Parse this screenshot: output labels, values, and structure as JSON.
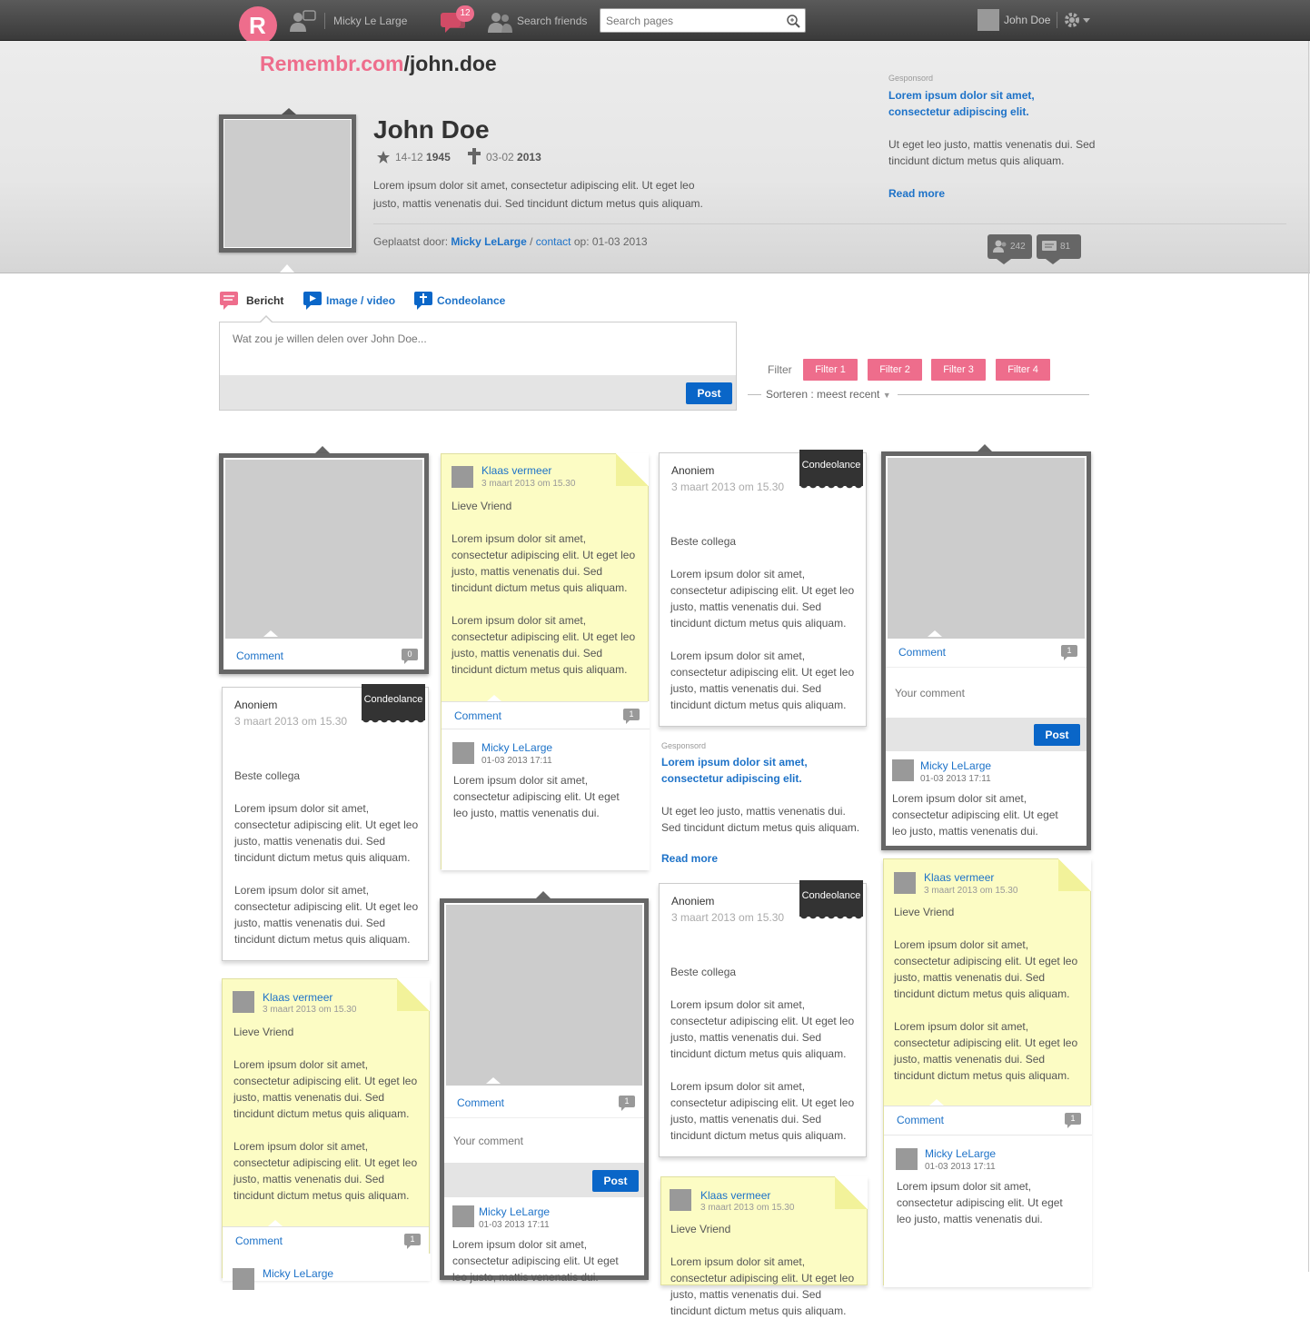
{
  "topbar": {
    "user_name": "Micky Le Large",
    "notification_count": "12",
    "search_friends": "Search friends",
    "search_placeholder": "Search pages",
    "account_name": "John Doe"
  },
  "logo": {
    "brand": "Remembr.com",
    "slug": "/john.doe"
  },
  "profile": {
    "name": "John Doe",
    "birth_day": "14-12",
    "birth_year": "1945",
    "death_day": "03-02",
    "death_year": "2013",
    "bio": "Lorem ipsum dolor sit amet, consectetur adipiscing elit. Ut eget leo justo, mattis venenatis dui. Sed tincidunt dictum metus quis aliquam.",
    "posted_by_label": "Geplaatst door:",
    "posted_by_name": "Micky LeLarge",
    "contact_label": "contact",
    "posted_on": "op: 01-03 2013",
    "followers_count": "242",
    "messages_count": "81"
  },
  "sponsored_header": {
    "label": "Gesponsord",
    "title": "Lorem ipsum dolor sit amet, consectetur adipiscing elit.",
    "body": "Ut eget leo justo, mattis venenatis dui. Sed tincidunt dictum metus quis aliquam.",
    "read_more": "Read more"
  },
  "compose": {
    "tabs": [
      "Bericht",
      "Image / video",
      "Condeolance"
    ],
    "placeholder": "Wat zou je willen delen over John Doe...",
    "post_label": "Post"
  },
  "filters": {
    "label": "Filter",
    "buttons": [
      "Filter 1",
      "Filter 2",
      "Filter 3",
      "Filter 4"
    ],
    "sort": "Sorteren : meest recent"
  },
  "common": {
    "comment": "Comment",
    "your_comment": "Your comment",
    "post": "Post",
    "condolence_badge": "Condeolance",
    "anon": "Anoniem",
    "date": "3 maart 2013 om 15.30",
    "greeting_colleague": "Beste collega",
    "greeting_friend": "Lieve Vriend",
    "klaas": "Klaas vermeer",
    "micky": "Micky LeLarge",
    "micky_date": "01-03 2013 17:11",
    "lorem_long": "Lorem ipsum dolor sit amet, consectetur adipiscing elit. Ut eget leo justo, mattis venenatis dui. Sed tincidunt dictum metus quis aliquam.",
    "lorem_short": "Lorem ipsum dolor sit amet, consectetur adipiscing elit. Ut eget leo justo, mattis venenatis dui.",
    "count_0": "0",
    "count_1": "1"
  },
  "sponsored_feed": {
    "label": "Gesponsord",
    "title": "Lorem ipsum dolor sit amet, consectetur adipiscing elit.",
    "body": "Ut eget leo justo, mattis venenatis dui. Sed tincidunt dictum metus quis aliquam.",
    "read_more": "Read more"
  }
}
